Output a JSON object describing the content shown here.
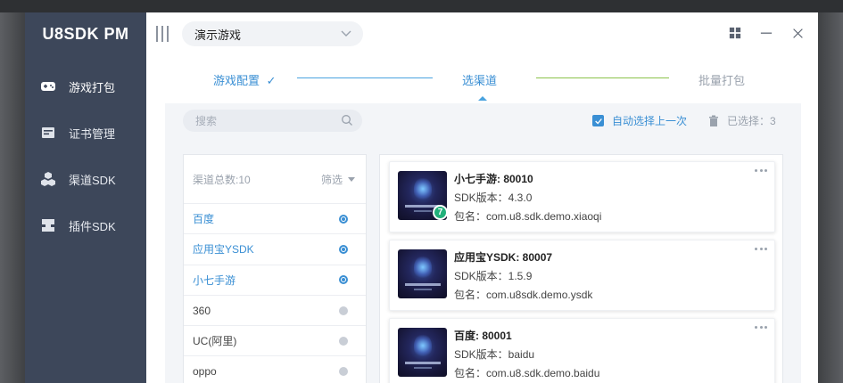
{
  "app": {
    "title": "U8SDK PM"
  },
  "sidebar": {
    "items": [
      {
        "label": "游戏打包",
        "icon": "gamepad-icon",
        "active": true
      },
      {
        "label": "证书管理",
        "icon": "certificate-icon",
        "active": false
      },
      {
        "label": "渠道SDK",
        "icon": "cubes-icon",
        "active": false
      },
      {
        "label": "插件SDK",
        "icon": "plugin-icon",
        "active": false
      }
    ]
  },
  "topbar": {
    "game_select": "演示游戏"
  },
  "steps": [
    {
      "label": "游戏配置",
      "state": "done"
    },
    {
      "label": "选渠道",
      "state": "current"
    },
    {
      "label": "批量打包",
      "state": "pending"
    }
  ],
  "toolbar": {
    "search_placeholder": "搜索",
    "auto_select_label": "自动选择上一次",
    "selected_count": "已选择：3"
  },
  "channel_list": {
    "header": "渠道总数:10",
    "filter_label": "筛选",
    "rows": [
      {
        "name": "百度",
        "selected": true
      },
      {
        "name": "应用宝YSDK",
        "selected": true
      },
      {
        "name": "小七手游",
        "selected": true
      },
      {
        "name": "360",
        "selected": false
      },
      {
        "name": "UC(阿里)",
        "selected": false
      },
      {
        "name": "oppo",
        "selected": false
      }
    ]
  },
  "cards": [
    {
      "title": "小七手游: 80010",
      "sdk_version": "SDK版本：4.3.0",
      "package": "包名：com.u8.sdk.demo.xiaoqi",
      "badge": "7"
    },
    {
      "title": "应用宝YSDK: 80007",
      "sdk_version": "SDK版本：1.5.9",
      "package": "包名：com.u8sdk.demo.ysdk",
      "badge": ""
    },
    {
      "title": "百度: 80001",
      "sdk_version": "SDK版本：baidu",
      "package": "包名：com.u8.sdk.demo.baidu",
      "badge": ""
    }
  ],
  "colors": {
    "sidebar_bg": "#3d475a",
    "accent_blue": "#3a8fd4",
    "accent_green": "#8bc34a",
    "badge_green": "#21b07a"
  }
}
